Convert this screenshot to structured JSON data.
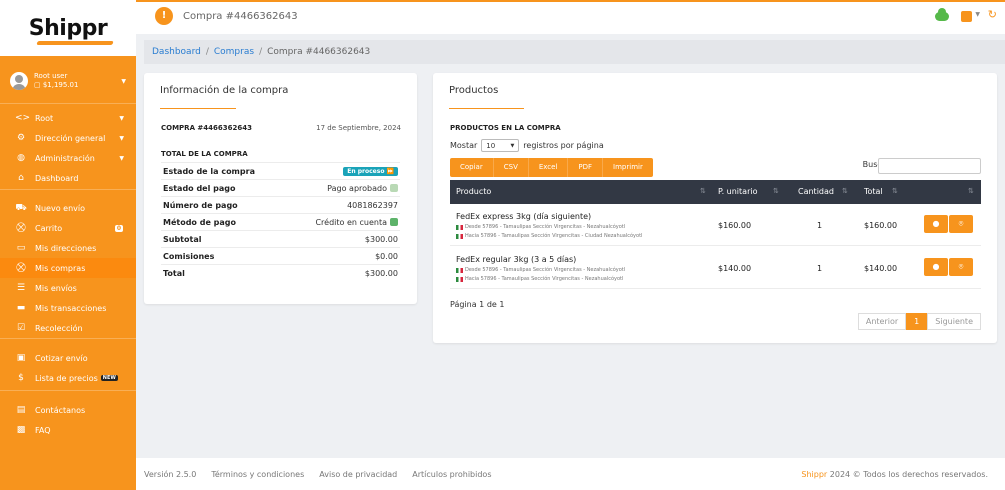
{
  "app": {
    "logo_text": "Shippr"
  },
  "user": {
    "name": "Root user",
    "balance": "$1,195.01"
  },
  "sidebar": {
    "items": [
      {
        "label": "Root",
        "icon": "code-icon",
        "glyph": "<>",
        "has_arrow": true
      },
      {
        "label": "Dirección general",
        "icon": "gear-icon",
        "glyph": "⚙",
        "has_arrow": true
      },
      {
        "label": "Administración",
        "icon": "globe-icon",
        "glyph": "◍",
        "has_arrow": true
      },
      {
        "label": "Dashboard",
        "icon": "home-icon",
        "glyph": "⌂"
      },
      {
        "label": "Nuevo envío",
        "icon": "truck-icon",
        "glyph": "⛟"
      },
      {
        "label": "Carrito",
        "icon": "cart-icon",
        "glyph": "⛒",
        "badge": "0"
      },
      {
        "label": "Mis direcciones",
        "icon": "address-card-icon",
        "glyph": "▭"
      },
      {
        "label": "Mis compras",
        "icon": "cart-plus-icon",
        "glyph": "⛒",
        "active": true
      },
      {
        "label": "Mis envíos",
        "icon": "list-icon",
        "glyph": "☰"
      },
      {
        "label": "Mis transacciones",
        "icon": "credit-card-icon",
        "glyph": "▬"
      },
      {
        "label": "Recolección",
        "icon": "calendar-check-icon",
        "glyph": "☑"
      },
      {
        "label": "Cotizar envío",
        "icon": "calculator-icon",
        "glyph": "▣"
      },
      {
        "label": "Lista de precios",
        "icon": "dollar-icon",
        "glyph": "$",
        "new_badge": "NEW"
      },
      {
        "label": "Contáctanos",
        "icon": "contact-card-icon",
        "glyph": "▤"
      },
      {
        "label": "FAQ",
        "icon": "faq-icon",
        "glyph": "▩"
      }
    ]
  },
  "topbar": {
    "badge": "!",
    "title": "Compra #4466362643"
  },
  "breadcrumb": {
    "items": [
      "Dashboard",
      "Compras"
    ],
    "current": "Compra #4466362643"
  },
  "info": {
    "title": "Información de la compra",
    "purchase_id": "COMPRA #4466362643",
    "date": "17 de Septiembre, 2024",
    "subtitle": "TOTAL DE LA COMPRA",
    "status_label": "Estado de la compra",
    "status_value": "En proceso ⏩",
    "rows": [
      {
        "label": "Estado del pago",
        "value": "Pago aprobado"
      },
      {
        "label": "Número de pago",
        "value": "4081862397"
      },
      {
        "label": "Método de pago",
        "value": "Crédito en cuenta"
      },
      {
        "label": "Subtotal",
        "value": "$300.00"
      },
      {
        "label": "Comisiones",
        "value": "$0.00"
      },
      {
        "label": "Total",
        "value": "$300.00"
      }
    ]
  },
  "products": {
    "title": "Productos",
    "section": "PRODUCTOS EN LA COMPRA",
    "show_prefix": "Mostar",
    "show_value": "10",
    "show_suffix": "registros por página",
    "buttons": [
      "Copiar",
      "CSV",
      "Excel",
      "PDF",
      "Imprimir"
    ],
    "search_label": "Buscar",
    "search_value": "",
    "columns": [
      "Producto",
      "P. unitario",
      "Cantidad",
      "Total"
    ],
    "rows": [
      {
        "name": "FedEx express 3kg (día siguiente)",
        "from": "Desde 57896 - Tamaulipas Sección Virgencitas - Nezahualcóyotl",
        "to": "Hacia 57896 - Tamaulipas Sección Virgencitas - Ciudad Nezahualcóyotl",
        "unit_price": "$160.00",
        "qty": "1",
        "total": "$160.00"
      },
      {
        "name": "FedEx regular 3kg (3 a 5 días)",
        "from": "Desde 57896 - Tamaulipas Sección Virgencitas - Nezahualcóyotl",
        "to": "Hacia 57896 - Tamaulipas Sección Virgencitas - Nezahualcóyotl",
        "unit_price": "$140.00",
        "qty": "1",
        "total": "$140.00"
      }
    ],
    "page_info": "Página 1 de 1",
    "pager": {
      "prev": "Anterior",
      "current": "1",
      "next": "Siguiente"
    }
  },
  "footer": {
    "version": "Versión 2.5.0",
    "links": [
      "Términos y condiciones",
      "Aviso de privacidad",
      "Artículos prohibidos"
    ],
    "brand": "Shippr",
    "copyright": "2024 © Todos los derechos reservados."
  },
  "colors": {
    "accent": "#f7941d",
    "table_header": "#323844",
    "link": "#2a7dd1",
    "status": "#1aa3b8"
  }
}
